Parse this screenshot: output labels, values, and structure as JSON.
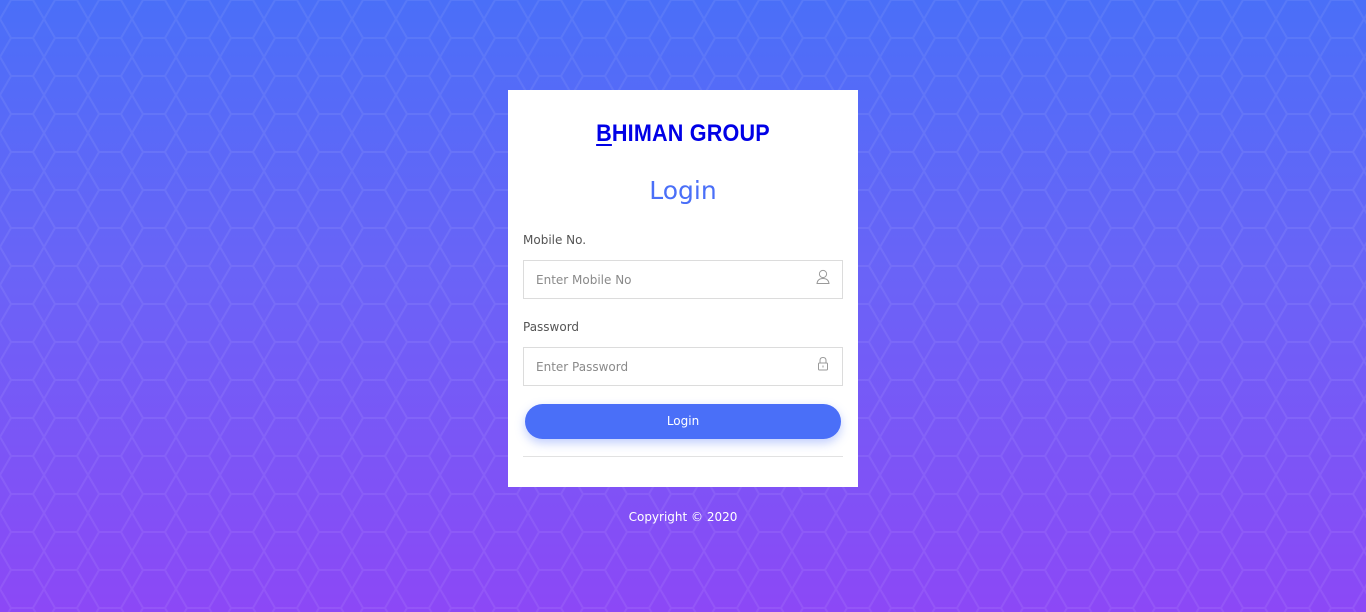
{
  "brand": {
    "first_letter": "B",
    "rest": "HIMAN GROUP"
  },
  "login_form": {
    "title": "Login",
    "mobile_label": "Mobile No.",
    "mobile_placeholder": "Enter Mobile No",
    "mobile_value": "",
    "password_label": "Password",
    "password_placeholder": "Enter Password",
    "password_value": "",
    "submit_label": "Login"
  },
  "icons": {
    "mobile_field": "user-icon",
    "password_field": "lock-icon"
  },
  "footer": {
    "copyright": "Copyright © 2020"
  },
  "colors": {
    "gradient_top": "#4a6ff8",
    "gradient_bottom": "#8c48f6",
    "accent": "#4a6ff8",
    "brand": "#0000e6",
    "card": "#ffffff"
  }
}
